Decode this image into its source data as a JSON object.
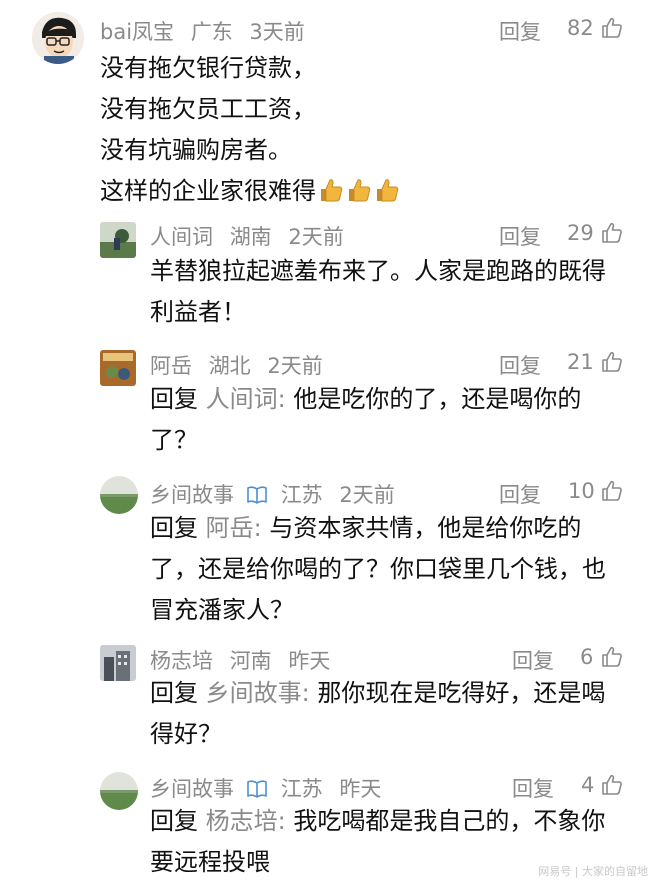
{
  "comments": [
    {
      "user": "bai凤宝",
      "location": "广东",
      "time": "3天前",
      "reply_label": "回复",
      "likes": "82",
      "lines": [
        "没有拖欠银行贷款，",
        "没有拖欠员工工资，",
        "没有坑骗购房者。",
        "这样的企业家很难得"
      ],
      "emoji": "thumbs-up x3"
    },
    {
      "user": "人间词",
      "location": "湖南",
      "time": "2天前",
      "reply_label": "回复",
      "likes": "29",
      "lines": [
        "羊替狼拉起遮羞布来了。人家是跑路的既得",
        "利益者！"
      ]
    },
    {
      "user": "阿岳",
      "location": "湖北",
      "time": "2天前",
      "reply_label": "回复",
      "likes": "21",
      "prefix": "回复",
      "mention": "人间词:",
      "lines": [
        "他是吃你的了，还是喝你的",
        "了？"
      ]
    },
    {
      "user": "乡间故事",
      "location": "江苏",
      "time": "2天前",
      "reply_label": "回复",
      "likes": "10",
      "prefix": "回复",
      "mention": "阿岳:",
      "lines": [
        "与资本家共情，他是给你吃的",
        "了，还是给你喝的了？你口袋里几个钱，也",
        "冒充潘家人？"
      ]
    },
    {
      "user": "杨志培",
      "location": "河南",
      "time": "昨天",
      "reply_label": "回复",
      "likes": "6",
      "prefix": "回复",
      "mention": "乡间故事:",
      "lines": [
        "那你现在是吃得好，还是喝",
        "得好？"
      ]
    },
    {
      "user": "乡间故事",
      "location": "江苏",
      "time": "昨天",
      "reply_label": "回复",
      "likes": "4",
      "prefix": "回复",
      "mention": "杨志培:",
      "lines": [
        "我吃喝都是我自己的，不象你",
        "要远程投喂"
      ]
    }
  ],
  "watermark": "网易号 | 大家的自留地",
  "colors": {
    "text": "#111111",
    "meta": "#8a8a8a",
    "background": "#ffffff"
  }
}
